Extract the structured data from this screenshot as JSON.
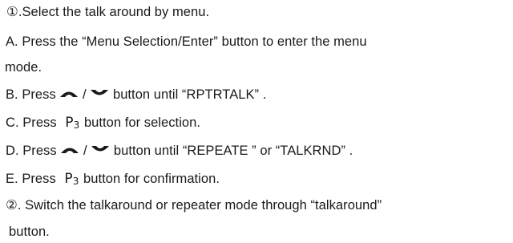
{
  "doc": {
    "line1": "①.Select the talk around by menu.",
    "line2": "A. Press the  “Menu Selection/Enter”  button to enter the menu",
    "line3": "mode.",
    "line4_pre": "B. Press",
    "line4_sep": "/",
    "line4_post": " button until  “RPTRTALK” .",
    "line5_pre": "C. Press ",
    "line5_post": " button for selection.",
    "line6_pre": "D. Press",
    "line6_sep": "/",
    "line6_post": " button until  “REPEATE ”  or  “TALKRND” .",
    "line7_pre": "E. Press ",
    "line7_post": " button for confirmation.",
    "line8": "②. Switch the talkaround or repeater mode through  “talkaround”",
    "line9": "button.",
    "p3_letter": "P",
    "p3_sub": "3"
  },
  "icons": {
    "up": "arch-up-arrow-icon",
    "down": "arch-down-arrow-icon"
  }
}
